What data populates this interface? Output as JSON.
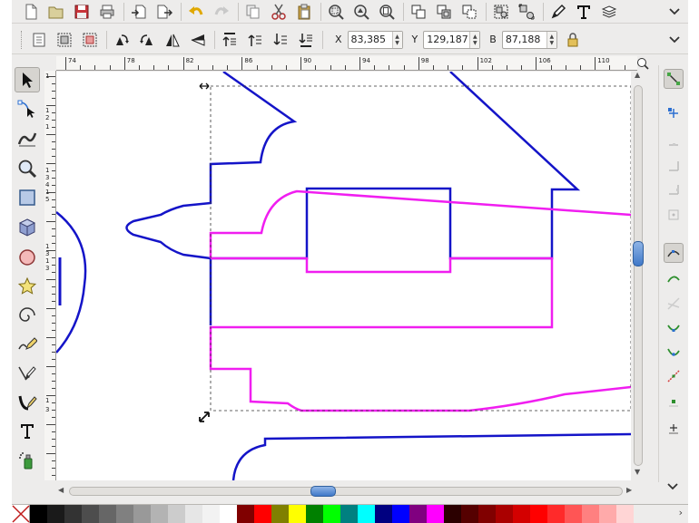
{
  "toolbar": {
    "icons": [
      "new-document-icon",
      "open-folder-icon",
      "save-icon",
      "print-icon",
      "import-icon",
      "export-icon",
      "undo-icon",
      "redo-icon",
      "copy-icon",
      "cut-icon",
      "paste-icon",
      "zoom-selection-icon",
      "zoom-drawing-icon",
      "zoom-page-icon",
      "duplicate-icon",
      "clone-icon",
      "unlink-clone-icon",
      "group-icon",
      "ungroup-icon",
      "fill-stroke-icon",
      "text-tool-icon",
      "layers-icon"
    ]
  },
  "selector_controls": {
    "x_label": "X",
    "x_value": "83,385",
    "y_label": "Y",
    "y_value": "129,187",
    "w_label": "B",
    "w_value": "87,188"
  },
  "ruler": {
    "h_labels": [
      "74",
      "78",
      "82",
      "86",
      "90",
      "94",
      "98",
      "102",
      "106",
      "110"
    ],
    "v_labels": [
      "1",
      "1",
      "2",
      "1",
      "1",
      "3",
      "4",
      "1",
      "5",
      "1",
      "3",
      "1",
      "3",
      "1",
      "3"
    ]
  },
  "tools": [
    "selector-tool-icon",
    "node-tool-icon",
    "tweak-tool-icon",
    "zoom-tool-icon",
    "rectangle-tool-icon",
    "3d-box-tool-icon",
    "ellipse-tool-icon",
    "star-tool-icon",
    "spiral-tool-icon",
    "pencil-tool-icon",
    "pen-tool-icon",
    "calligraphy-tool-icon",
    "text-tool-icon",
    "spray-tool-icon"
  ],
  "snap_controls": [
    "snap-toggle-icon",
    "snap-bbox-icon",
    "snap-bbox-edge-icon",
    "snap-bbox-corner-icon",
    "snap-bbox-midpoint-icon",
    "snap-bbox-center-icon",
    "snap-nodes-icon",
    "snap-path-icon",
    "snap-intersection-icon",
    "snap-cusp-icon",
    "snap-smooth-icon",
    "snap-midpoint-icon",
    "snap-center-icon",
    "snap-rotation-center-icon"
  ],
  "palette": {
    "colors": [
      "#000000",
      "#1a1a1a",
      "#333333",
      "#4d4d4d",
      "#666666",
      "#808080",
      "#999999",
      "#b3b3b3",
      "#cccccc",
      "#e6e6e6",
      "#f2f2f2",
      "#ffffff",
      "#800000",
      "#ff0000",
      "#808000",
      "#ffff00",
      "#008000",
      "#00ff00",
      "#008080",
      "#00ffff",
      "#000080",
      "#0000ff",
      "#800080",
      "#ff00ff",
      "#2b0000",
      "#550000",
      "#800000",
      "#aa0000",
      "#d40000",
      "#ff0000",
      "#ff2a2a",
      "#ff5555",
      "#ff8080",
      "#ffaaaa",
      "#ffd5d5"
    ]
  },
  "colors": {
    "blue_stroke": "#1414c8",
    "magenta_stroke": "#f01ef0"
  }
}
